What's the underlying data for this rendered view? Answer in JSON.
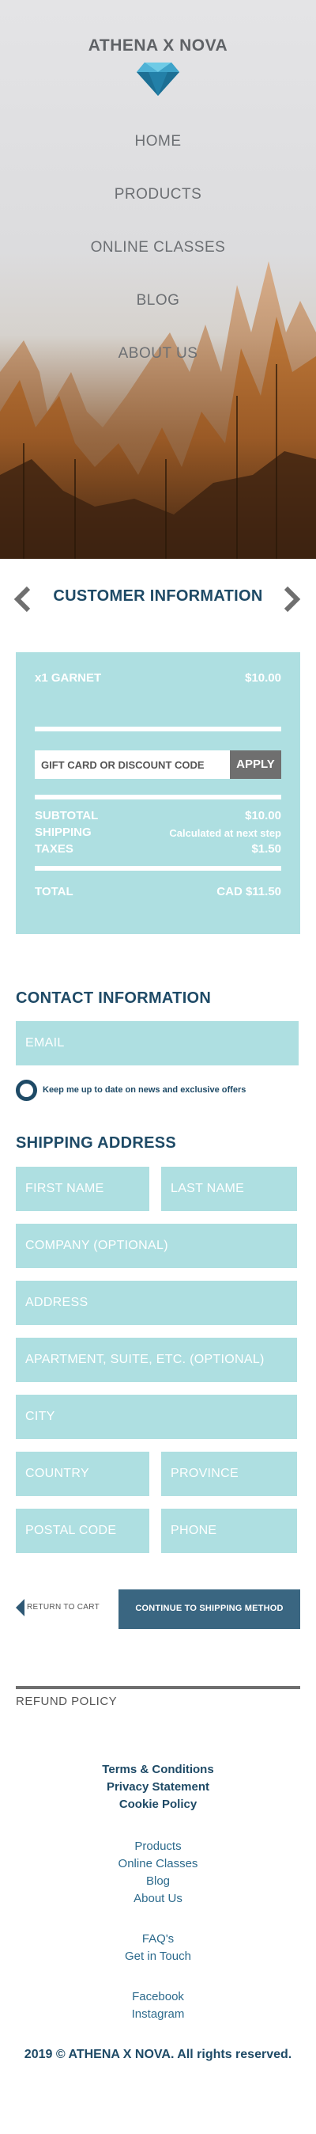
{
  "brand": {
    "name": "ATHENA X NOVA"
  },
  "nav": [
    "HOME",
    "PRODUCTS",
    "ONLINE CLASSES",
    "BLOG",
    "ABOUT US"
  ],
  "step": {
    "title": "CUSTOMER INFORMATION",
    "prev_icon": "chevron-left-icon",
    "next_icon": "chevron-right-icon"
  },
  "summary": {
    "item_label": "x1 GARNET",
    "item_price": "$10.00",
    "discount_placeholder": "GIFT CARD OR DISCOUNT CODE",
    "apply_label": "APPLY",
    "subtotal_label": "SUBTOTAL",
    "subtotal_value": "$10.00",
    "shipping_label": "SHIPPING",
    "shipping_value": "Calculated at next step",
    "taxes_label": "TAXES",
    "taxes_value": "$1.50",
    "total_label": "TOTAL",
    "total_value": "CAD $11.50"
  },
  "contact": {
    "title": "CONTACT INFORMATION",
    "email_placeholder": "EMAIL",
    "newsletter_label": "Keep me up to date on news and exclusive offers"
  },
  "shipping": {
    "title": "SHIPPING ADDRESS",
    "first_name": "FIRST NAME",
    "last_name": "LAST NAME",
    "company": "COMPANY (OPTIONAL)",
    "address": "ADDRESS",
    "apartment": "APARTMENT, SUITE, ETC. (OPTIONAL)",
    "city": "CITY",
    "country": "COUNTRY",
    "province": "PROVINCE",
    "postal_code": "POSTAL CODE",
    "phone": "PHONE"
  },
  "actions": {
    "return_label": "RETURN TO CART",
    "continue_label": "CONTINUE TO SHIPPING METHOD"
  },
  "footer": {
    "refund": "REFUND POLICY",
    "legal": [
      "Terms & Conditions",
      "Privacy Statement",
      "Cookie Policy"
    ],
    "links1": [
      "Products",
      "Online Classes",
      "Blog",
      "About Us"
    ],
    "links2": [
      "FAQ's",
      "Get in Touch"
    ],
    "social": [
      "Facebook",
      "Instagram"
    ],
    "copyright": "2019  © ATHENA X NOVA. All rights reserved."
  },
  "colors": {
    "accent": "#1e4a66",
    "field": "#aedfe1",
    "button": "#3a6681",
    "apply": "#6f6f6f"
  }
}
